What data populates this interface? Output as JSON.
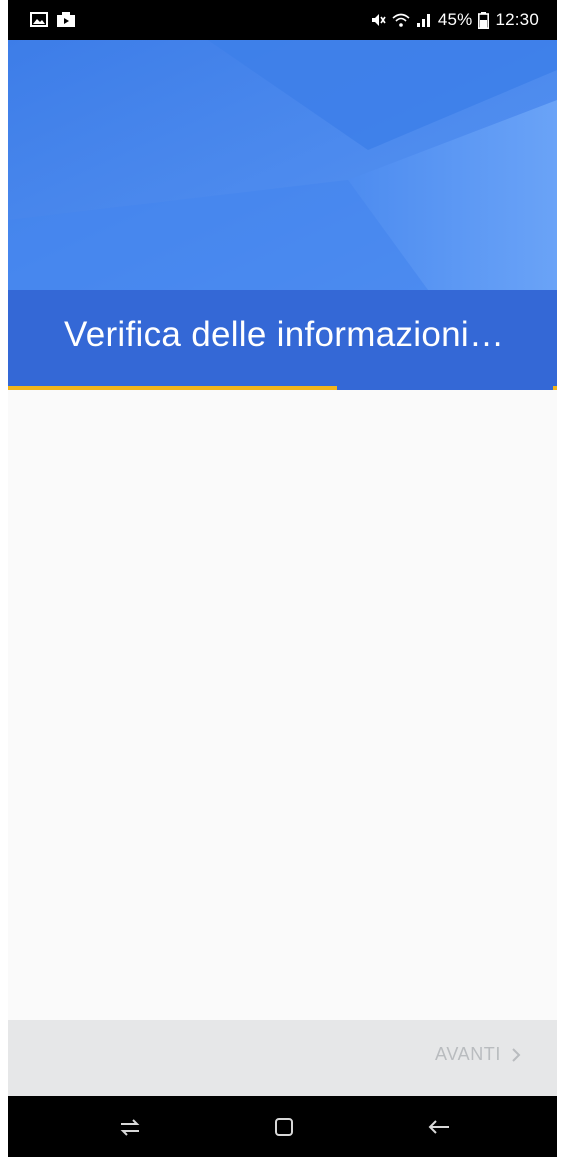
{
  "status_bar": {
    "left_icons": [
      "gallery-icon",
      "camera-icon"
    ],
    "right_icons": [
      "mute-icon",
      "wifi-icon",
      "signal-icon"
    ],
    "battery_percent": "45%",
    "battery_icon": "battery-icon",
    "time": "12:30"
  },
  "header": {
    "title": "Verifica delle informazioni…",
    "progress_fraction": 0.6
  },
  "footer": {
    "next_label": "AVANTI",
    "next_icon": "chevron-right-icon"
  },
  "nav_bar": {
    "icons": [
      "recent-apps-icon",
      "home-icon",
      "back-icon"
    ]
  },
  "colors": {
    "hero_blue": "#4a8af0",
    "title_band_blue": "#3468d6",
    "progress_yellow": "#f2b51a",
    "content_bg": "#fafafa",
    "footer_bg": "#e6e7e8",
    "disabled_text": "#b9bcbf"
  }
}
